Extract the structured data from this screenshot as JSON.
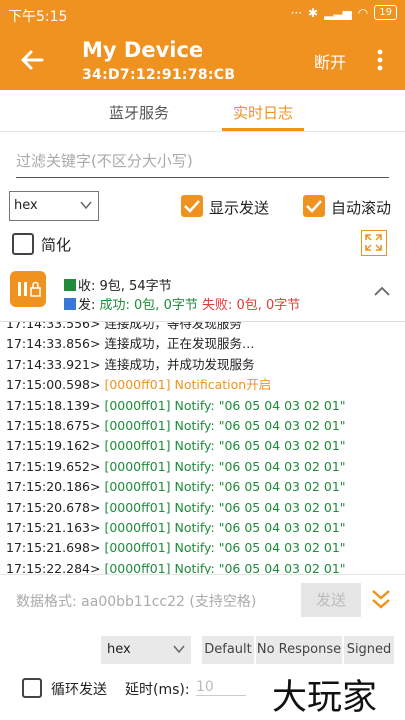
{
  "status_bar": {
    "time": "下午5:15",
    "battery": "19"
  },
  "app_bar": {
    "title": "My Device",
    "subtitle": "34:D7:12:91:78:CB",
    "disconnect_label": "断开"
  },
  "tabs": [
    {
      "label": "蓝牙服务"
    },
    {
      "label": "实时日志"
    }
  ],
  "filter": {
    "placeholder": "过滤关键字(不区分大小写)"
  },
  "controls": {
    "format_select": "hex",
    "show_send_label": "显示发送",
    "auto_scroll_label": "自动滚动",
    "simplify_label": "简化"
  },
  "stats": {
    "recv_label": "收: 9包, 54字节",
    "send_prefix": "发: ",
    "send_success": "成功: 0包, 0字节",
    "send_fail": "失败: 0包, 0字节"
  },
  "log": [
    {
      "time": "17:14:33.856>",
      "text": "连接成功，正在发现服务…",
      "color": "black"
    },
    {
      "time": "17:14:33.921>",
      "text": "连接成功，并成功发现服务",
      "color": "black"
    },
    {
      "time": "17:15:00.598>",
      "text": "[0000ff01] Notification开启",
      "color": "orange"
    },
    {
      "time": "17:15:18.139>",
      "text": "[0000ff01] Notify: \"06 05 04 03 02 01\"",
      "color": "green"
    },
    {
      "time": "17:15:18.675>",
      "text": "[0000ff01] Notify: \"06 05 04 03 02 01\"",
      "color": "green"
    },
    {
      "time": "17:15:19.162>",
      "text": "[0000ff01] Notify: \"06 05 04 03 02 01\"",
      "color": "green"
    },
    {
      "time": "17:15:19.652>",
      "text": "[0000ff01] Notify: \"06 05 04 03 02 01\"",
      "color": "green"
    },
    {
      "time": "17:15:20.186>",
      "text": "[0000ff01] Notify: \"06 05 04 03 02 01\"",
      "color": "green"
    },
    {
      "time": "17:15:20.678>",
      "text": "[0000ff01] Notify: \"06 05 04 03 02 01\"",
      "color": "green"
    },
    {
      "time": "17:15:21.163>",
      "text": "[0000ff01] Notify: \"06 05 04 03 02 01\"",
      "color": "green"
    },
    {
      "time": "17:15:21.698>",
      "text": "[0000ff01] Notify: \"06 05 04 03 02 01\"",
      "color": "green"
    },
    {
      "time": "17:15:22.284>",
      "text": "[0000ff01] Notify: \"06 05 04 03 02 01\"",
      "color": "green"
    }
  ],
  "bottom": {
    "data_placeholder": "数据格式: aa00bb11cc22 (支持空格)",
    "send_label": "发送",
    "format_select": "hex",
    "options": [
      "Default",
      "No Response",
      "Signed"
    ],
    "loop_label": "循环发送",
    "delay_label": "延时(ms):",
    "delay_value": "10",
    "watermark": "大玩家"
  },
  "colors": {
    "accent": "#f0921f",
    "notify": "#1e8c3a",
    "fail": "#e53935"
  }
}
